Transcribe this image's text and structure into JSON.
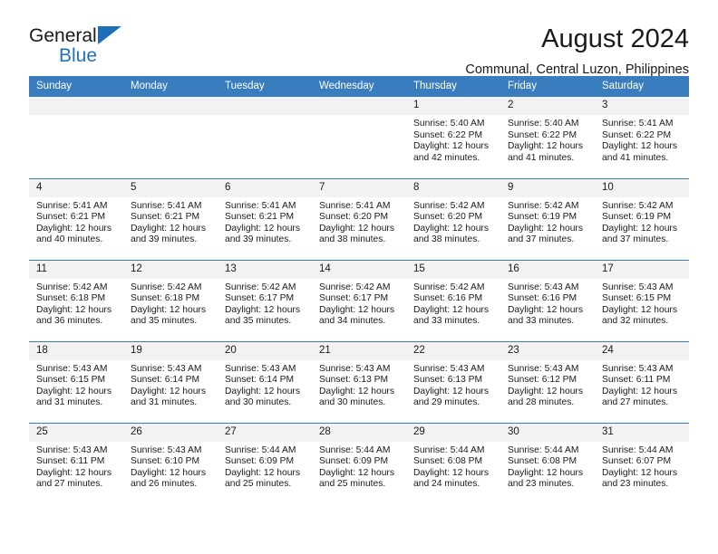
{
  "brand": {
    "line1": "General",
    "line2": "Blue",
    "triangle_color": "#1f6fb8"
  },
  "header": {
    "month_title": "August 2024",
    "location": "Communal, Central Luzon, Philippines"
  },
  "theme": {
    "header_blue": "#3a7dbf",
    "daynum_gray": "#f2f2f2",
    "text": "#1a1a1a"
  },
  "weekday_headers": [
    "Sunday",
    "Monday",
    "Tuesday",
    "Wednesday",
    "Thursday",
    "Friday",
    "Saturday"
  ],
  "labels": {
    "sunrise_prefix": "Sunrise: ",
    "sunset_prefix": "Sunset: ",
    "daylight_prefix": "Daylight: "
  },
  "weeks": [
    [
      {
        "day": "",
        "blank": true
      },
      {
        "day": "",
        "blank": true
      },
      {
        "day": "",
        "blank": true
      },
      {
        "day": "",
        "blank": true
      },
      {
        "day": "1",
        "sunrise": "Sunrise: 5:40 AM",
        "sunset": "Sunset: 6:22 PM",
        "daylight_1": "Daylight: 12 hours",
        "daylight_2": "and 42 minutes."
      },
      {
        "day": "2",
        "sunrise": "Sunrise: 5:40 AM",
        "sunset": "Sunset: 6:22 PM",
        "daylight_1": "Daylight: 12 hours",
        "daylight_2": "and 41 minutes."
      },
      {
        "day": "3",
        "sunrise": "Sunrise: 5:41 AM",
        "sunset": "Sunset: 6:22 PM",
        "daylight_1": "Daylight: 12 hours",
        "daylight_2": "and 41 minutes."
      }
    ],
    [
      {
        "day": "4",
        "sunrise": "Sunrise: 5:41 AM",
        "sunset": "Sunset: 6:21 PM",
        "daylight_1": "Daylight: 12 hours",
        "daylight_2": "and 40 minutes."
      },
      {
        "day": "5",
        "sunrise": "Sunrise: 5:41 AM",
        "sunset": "Sunset: 6:21 PM",
        "daylight_1": "Daylight: 12 hours",
        "daylight_2": "and 39 minutes."
      },
      {
        "day": "6",
        "sunrise": "Sunrise: 5:41 AM",
        "sunset": "Sunset: 6:21 PM",
        "daylight_1": "Daylight: 12 hours",
        "daylight_2": "and 39 minutes."
      },
      {
        "day": "7",
        "sunrise": "Sunrise: 5:41 AM",
        "sunset": "Sunset: 6:20 PM",
        "daylight_1": "Daylight: 12 hours",
        "daylight_2": "and 38 minutes."
      },
      {
        "day": "8",
        "sunrise": "Sunrise: 5:42 AM",
        "sunset": "Sunset: 6:20 PM",
        "daylight_1": "Daylight: 12 hours",
        "daylight_2": "and 38 minutes."
      },
      {
        "day": "9",
        "sunrise": "Sunrise: 5:42 AM",
        "sunset": "Sunset: 6:19 PM",
        "daylight_1": "Daylight: 12 hours",
        "daylight_2": "and 37 minutes."
      },
      {
        "day": "10",
        "sunrise": "Sunrise: 5:42 AM",
        "sunset": "Sunset: 6:19 PM",
        "daylight_1": "Daylight: 12 hours",
        "daylight_2": "and 37 minutes."
      }
    ],
    [
      {
        "day": "11",
        "sunrise": "Sunrise: 5:42 AM",
        "sunset": "Sunset: 6:18 PM",
        "daylight_1": "Daylight: 12 hours",
        "daylight_2": "and 36 minutes."
      },
      {
        "day": "12",
        "sunrise": "Sunrise: 5:42 AM",
        "sunset": "Sunset: 6:18 PM",
        "daylight_1": "Daylight: 12 hours",
        "daylight_2": "and 35 minutes."
      },
      {
        "day": "13",
        "sunrise": "Sunrise: 5:42 AM",
        "sunset": "Sunset: 6:17 PM",
        "daylight_1": "Daylight: 12 hours",
        "daylight_2": "and 35 minutes."
      },
      {
        "day": "14",
        "sunrise": "Sunrise: 5:42 AM",
        "sunset": "Sunset: 6:17 PM",
        "daylight_1": "Daylight: 12 hours",
        "daylight_2": "and 34 minutes."
      },
      {
        "day": "15",
        "sunrise": "Sunrise: 5:42 AM",
        "sunset": "Sunset: 6:16 PM",
        "daylight_1": "Daylight: 12 hours",
        "daylight_2": "and 33 minutes."
      },
      {
        "day": "16",
        "sunrise": "Sunrise: 5:43 AM",
        "sunset": "Sunset: 6:16 PM",
        "daylight_1": "Daylight: 12 hours",
        "daylight_2": "and 33 minutes."
      },
      {
        "day": "17",
        "sunrise": "Sunrise: 5:43 AM",
        "sunset": "Sunset: 6:15 PM",
        "daylight_1": "Daylight: 12 hours",
        "daylight_2": "and 32 minutes."
      }
    ],
    [
      {
        "day": "18",
        "sunrise": "Sunrise: 5:43 AM",
        "sunset": "Sunset: 6:15 PM",
        "daylight_1": "Daylight: 12 hours",
        "daylight_2": "and 31 minutes."
      },
      {
        "day": "19",
        "sunrise": "Sunrise: 5:43 AM",
        "sunset": "Sunset: 6:14 PM",
        "daylight_1": "Daylight: 12 hours",
        "daylight_2": "and 31 minutes."
      },
      {
        "day": "20",
        "sunrise": "Sunrise: 5:43 AM",
        "sunset": "Sunset: 6:14 PM",
        "daylight_1": "Daylight: 12 hours",
        "daylight_2": "and 30 minutes."
      },
      {
        "day": "21",
        "sunrise": "Sunrise: 5:43 AM",
        "sunset": "Sunset: 6:13 PM",
        "daylight_1": "Daylight: 12 hours",
        "daylight_2": "and 30 minutes."
      },
      {
        "day": "22",
        "sunrise": "Sunrise: 5:43 AM",
        "sunset": "Sunset: 6:13 PM",
        "daylight_1": "Daylight: 12 hours",
        "daylight_2": "and 29 minutes."
      },
      {
        "day": "23",
        "sunrise": "Sunrise: 5:43 AM",
        "sunset": "Sunset: 6:12 PM",
        "daylight_1": "Daylight: 12 hours",
        "daylight_2": "and 28 minutes."
      },
      {
        "day": "24",
        "sunrise": "Sunrise: 5:43 AM",
        "sunset": "Sunset: 6:11 PM",
        "daylight_1": "Daylight: 12 hours",
        "daylight_2": "and 27 minutes."
      }
    ],
    [
      {
        "day": "25",
        "sunrise": "Sunrise: 5:43 AM",
        "sunset": "Sunset: 6:11 PM",
        "daylight_1": "Daylight: 12 hours",
        "daylight_2": "and 27 minutes."
      },
      {
        "day": "26",
        "sunrise": "Sunrise: 5:43 AM",
        "sunset": "Sunset: 6:10 PM",
        "daylight_1": "Daylight: 12 hours",
        "daylight_2": "and 26 minutes."
      },
      {
        "day": "27",
        "sunrise": "Sunrise: 5:44 AM",
        "sunset": "Sunset: 6:09 PM",
        "daylight_1": "Daylight: 12 hours",
        "daylight_2": "and 25 minutes."
      },
      {
        "day": "28",
        "sunrise": "Sunrise: 5:44 AM",
        "sunset": "Sunset: 6:09 PM",
        "daylight_1": "Daylight: 12 hours",
        "daylight_2": "and 25 minutes."
      },
      {
        "day": "29",
        "sunrise": "Sunrise: 5:44 AM",
        "sunset": "Sunset: 6:08 PM",
        "daylight_1": "Daylight: 12 hours",
        "daylight_2": "and 24 minutes."
      },
      {
        "day": "30",
        "sunrise": "Sunrise: 5:44 AM",
        "sunset": "Sunset: 6:08 PM",
        "daylight_1": "Daylight: 12 hours",
        "daylight_2": "and 23 minutes."
      },
      {
        "day": "31",
        "sunrise": "Sunrise: 5:44 AM",
        "sunset": "Sunset: 6:07 PM",
        "daylight_1": "Daylight: 12 hours",
        "daylight_2": "and 23 minutes."
      }
    ]
  ]
}
